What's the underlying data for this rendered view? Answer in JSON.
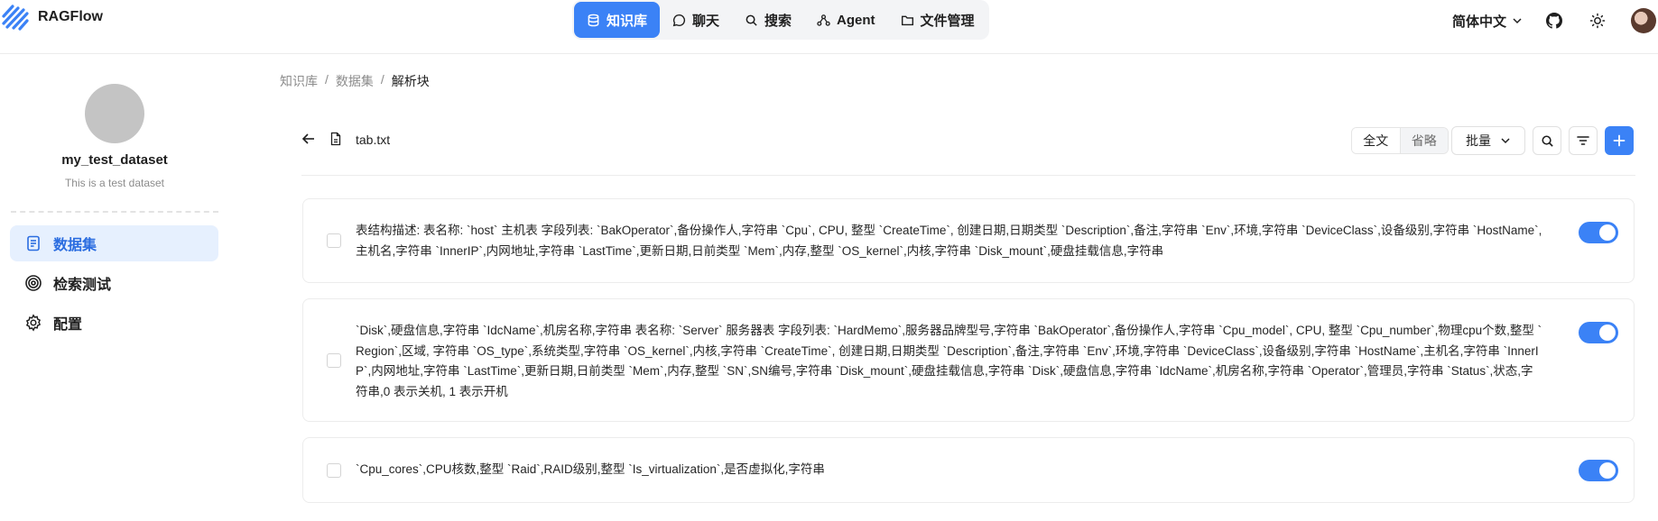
{
  "app": {
    "brand": "RAGFlow"
  },
  "nav": {
    "items": [
      {
        "label": "知识库",
        "icon": "database-icon",
        "active": true
      },
      {
        "label": "聊天",
        "icon": "chat-bubble-icon"
      },
      {
        "label": "搜索",
        "icon": "search-icon"
      },
      {
        "label": "Agent",
        "icon": "agent-graph-icon"
      },
      {
        "label": "文件管理",
        "icon": "folder-icon"
      }
    ]
  },
  "header": {
    "language": "简体中文"
  },
  "sidebar": {
    "dataset_name": "my_test_dataset",
    "dataset_description": "This is a test dataset",
    "items": [
      {
        "label": "数据集",
        "icon": "document-icon",
        "active": true
      },
      {
        "label": "检索测试",
        "icon": "target-icon"
      },
      {
        "label": "配置",
        "icon": "gear-icon"
      }
    ]
  },
  "breadcrumb": {
    "items": [
      "知识库",
      "数据集",
      "解析块"
    ],
    "separator": "/"
  },
  "toolbar": {
    "file_name": "tab.txt",
    "view_full": "全文",
    "view_ellipsis": "省略",
    "batch_label": "批量"
  },
  "chunks": [
    {
      "text": "表结构描述: 表名称: `host` 主机表 字段列表: `BakOperator`,备份操作人,字符串 `Cpu`, CPU, 整型 `CreateTime`, 创建日期,日期类型 `Description`,备注,字符串 `Env`,环境,字符串 `DeviceClass`,设备级别,字符串 `HostName`,主机名,字符串 `InnerIP`,内网地址,字符串 `LastTime`,更新日期,日前类型 `Mem`,内存,整型 `OS_kernel`,内核,字符串 `Disk_mount`,硬盘挂载信息,字符串",
      "enabled": true
    },
    {
      "text": "`Disk`,硬盘信息,字符串 `IdcName`,机房名称,字符串 表名称: `Server` 服务器表 字段列表: `HardMemo`,服务器品牌型号,字符串 `BakOperator`,备份操作人,字符串 `Cpu_model`, CPU, 整型 `Cpu_number`,物理cpu个数,整型 `Region`,区域, 字符串 `OS_type`,系统类型,字符串 `OS_kernel`,内核,字符串 `CreateTime`, 创建日期,日期类型 `Description`,备注,字符串 `Env`,环境,字符串 `DeviceClass`,设备级别,字符串 `HostName`,主机名,字符串 `InnerIP`,内网地址,字符串 `LastTime`,更新日期,日前类型 `Mem`,内存,整型 `SN`,SN编号,字符串 `Disk_mount`,硬盘挂载信息,字符串 `Disk`,硬盘信息,字符串 `IdcName`,机房名称,字符串 `Operator`,管理员,字符串 `Status`,状态,字符串,0 表示关机, 1 表示开机",
      "enabled": true
    },
    {
      "text": "`Cpu_cores`,CPU核数,整型 `Raid`,RAID级别,整型 `Is_virtualization`,是否虚拟化,字符串",
      "enabled": true
    }
  ],
  "colors": {
    "accent": "#3b82f6",
    "active_bg": "#e6f0fe"
  }
}
